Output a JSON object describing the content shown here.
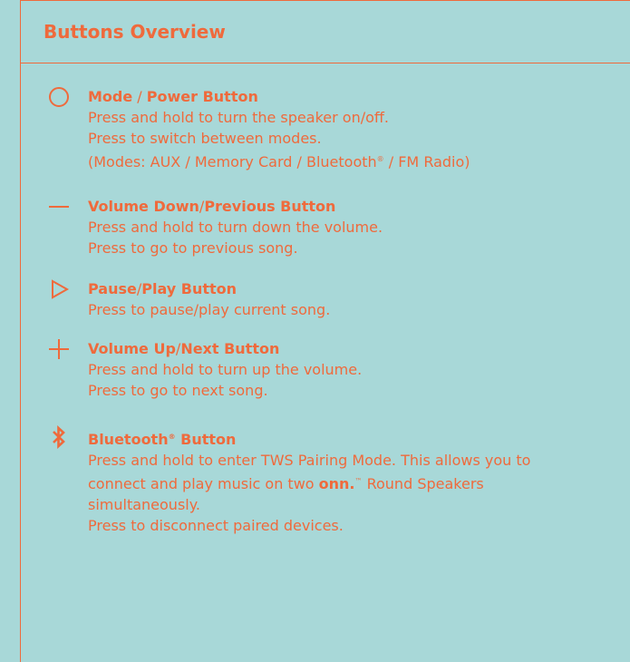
{
  "header": {
    "title": "Buttons Overview"
  },
  "buttons": [
    {
      "icon": "circle-icon",
      "title_a": "Mode",
      "title_sep": " / ",
      "title_b": "Power Button",
      "lines": [
        "Press and hold to turn the speaker on/off.",
        "Press to switch between modes.",
        "(Modes: AUX / Memory Card / Bluetooth",
        " / FM Radio)"
      ]
    },
    {
      "icon": "minus-icon",
      "title_a": "Volume Down",
      "title_sep": "/",
      "title_b": "Previous Button",
      "lines": [
        "Press and hold to turn down the volume.",
        "Press to go to previous song."
      ]
    },
    {
      "icon": "play-icon",
      "title_a": "Pause",
      "title_sep": "/",
      "title_b": "Play Button",
      "lines": [
        "Press to pause/play current song."
      ]
    },
    {
      "icon": "plus-icon",
      "title_a": "Volume Up",
      "title_sep": "/",
      "title_b": "Next Button",
      "lines": [
        "Press and hold to turn up the volume.",
        "Press to go to next song."
      ]
    },
    {
      "icon": "bluetooth-icon",
      "title_a": "Bluetooth",
      "title_reg": "®",
      "title_b": " Button",
      "lines": [
        "Press and hold to enter TWS Pairing Mode. This allows you to",
        "connect and play music on two ",
        "onn.",
        "™",
        " Round Speakers",
        "simultaneously.",
        "Press to disconnect paired devices."
      ]
    }
  ],
  "reg_mark": "®",
  "colors": {
    "accent": "#ef6a3c",
    "background": "#a8d8d8"
  }
}
